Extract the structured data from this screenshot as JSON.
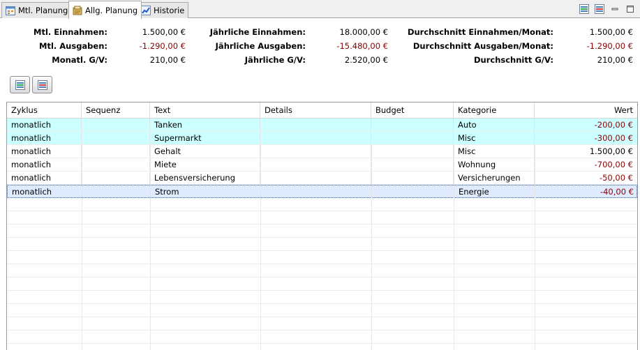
{
  "tabs": [
    {
      "label": "Mtl. Planung",
      "icon": "calendar-icon",
      "active": false
    },
    {
      "label": "Allg. Planung",
      "icon": "planning-icon",
      "active": true
    },
    {
      "label": "Historie",
      "icon": "chart-icon",
      "active": false
    }
  ],
  "summary": {
    "monthly_income_label": "Mtl. Einnahmen:",
    "monthly_income": "1.500,00 €",
    "monthly_expense_label": "Mtl. Ausgaben:",
    "monthly_expense": "-1.290,00 €",
    "monthly_pl_label": "Monatl. G/V:",
    "monthly_pl": "210,00 €",
    "yearly_income_label": "Jährliche Einnahmen:",
    "yearly_income": "18.000,00 €",
    "yearly_expense_label": "Jährliche Ausgaben:",
    "yearly_expense": "-15.480,00 €",
    "yearly_pl_label": "Jährliche G/V:",
    "yearly_pl": "2.520,00 €",
    "avg_income_label": "Durchschnitt Einnahmen/Monat:",
    "avg_income": "1.500,00 €",
    "avg_expense_label": "Durchschnitt Ausgaben/Monat:",
    "avg_expense": "-1.290,00 €",
    "avg_pl_label": "Durchschnitt G/V:",
    "avg_pl": "210,00 €"
  },
  "colors": {
    "negative": "#8b0000",
    "highlight_row": "#ccffff",
    "selected_row": "#dfeaff"
  },
  "table": {
    "columns": [
      "Zyklus",
      "Sequenz",
      "Text",
      "Details",
      "Budget",
      "Kategorie",
      "Wert"
    ],
    "rows": [
      {
        "zyklus": "monatlich",
        "sequenz": "",
        "text": "Tanken",
        "details": "",
        "budget": "",
        "kategorie": "Auto",
        "wert": "-200,00 €",
        "state": "highlight"
      },
      {
        "zyklus": "monatlich",
        "sequenz": "",
        "text": "Supermarkt",
        "details": "",
        "budget": "",
        "kategorie": "Misc",
        "wert": "-300,00 €",
        "state": "highlight"
      },
      {
        "zyklus": "monatlich",
        "sequenz": "",
        "text": "Gehalt",
        "details": "",
        "budget": "",
        "kategorie": "Misc",
        "wert": "1.500,00 €",
        "state": "normal"
      },
      {
        "zyklus": "monatlich",
        "sequenz": "",
        "text": "Miete",
        "details": "",
        "budget": "",
        "kategorie": "Wohnung",
        "wert": "-700,00 €",
        "state": "normal"
      },
      {
        "zyklus": "monatlich",
        "sequenz": "",
        "text": "Lebensversicherung",
        "details": "",
        "budget": "",
        "kategorie": "Versicherungen",
        "wert": "-50,00 €",
        "state": "normal"
      },
      {
        "zyklus": "monatlich",
        "sequenz": "",
        "text": "Strom",
        "details": "",
        "budget": "",
        "kategorie": "Energie",
        "wert": "-40,00 €",
        "state": "selected"
      }
    ]
  }
}
